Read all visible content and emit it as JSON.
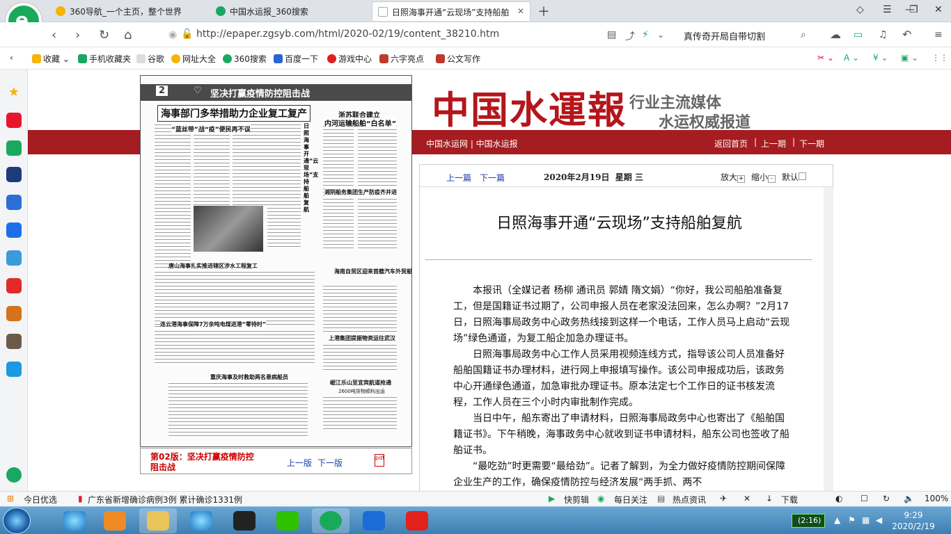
{
  "tabs": [
    {
      "title": "360导航_一个主页，整个世界",
      "color": "#f5b400"
    },
    {
      "title": "中国水运报_360搜索",
      "color": "#1aa860"
    },
    {
      "title": "日照海事开通“云现场”支持船舶",
      "color": "#bbbbbb"
    }
  ],
  "address": {
    "url": "http://epaper.zgsyb.com/html/2020-02/19/content_38210.htm",
    "search_text": "真传奇开局自带切割"
  },
  "bookmarks": [
    {
      "label": "收藏",
      "color": "#f5b400"
    },
    {
      "label": "手机收藏夹",
      "color": "#1aa860"
    },
    {
      "label": "谷歌",
      "color": "#999999"
    },
    {
      "label": "网址大全",
      "color": "#f5b400"
    },
    {
      "label": "360搜索",
      "color": "#1aa860"
    },
    {
      "label": "百度一下",
      "color": "#2a63d4"
    },
    {
      "label": "游戏中心",
      "color": "#e02020"
    },
    {
      "label": "六字亮点",
      "color": "#c0392b"
    },
    {
      "label": "公文写作",
      "color": "#c0392b"
    }
  ],
  "newspaper": {
    "masthead": "中国水運報",
    "slogan1": "行业主流媒体",
    "slogan2": "水运权威报道",
    "nav_left": "中国水运网 | 中国水运报",
    "nav_right": [
      "返回首页",
      "上一期",
      "下一期"
    ],
    "page_image": {
      "banner": "坚决打赢疫情防控阻击战",
      "page_no": "2",
      "headline": "海事部门多举措助力企业复工复产",
      "sub1": "“蓝丝带”战“疫”便民再不误",
      "sub2": "浙苏联合建立",
      "sub2b": "内河运输船舶“白名单”",
      "sub3": "湘阴船务集团生产防疫齐并进",
      "sub4": "唐山海事扎实推进辖区涉水工程复工",
      "sub5": "连云港海事保障7万余吨电煤进港“零待时”",
      "sub6": "海南自贸区迎来首艘汽车外贸船",
      "sub7": "上港集团提振物资运往武汉",
      "sub8": "重庆海事及时救助两名患病船员",
      "sub9": "岷江乐山至宜宾航道抢通",
      "sub9b": "2600吨货物顺利出运",
      "vert": "日照海事开通“云现场”支持船舶复航"
    },
    "caption": {
      "title": "第02版：坚决打赢疫情防控阻击战",
      "prev": "上一版",
      "next": "下一版"
    }
  },
  "article": {
    "prev": "上一篇",
    "next": "下一篇",
    "date": "2020年2月19日  星期 三",
    "zoom_in": "放大",
    "zoom_out": "缩小",
    "default": "默认",
    "title": "日照海事开通“云现场”支持船舶复航",
    "p1": "本报讯（全媒记者 杨柳 通讯员 郭婧 隋文娟）“你好，我公司船舶准备复工，但是国籍证书过期了，公司申报人员在老家没法回来，怎么办啊？”2月17日，日照海事局政务中心政务热线接到这样一个电话，工作人员马上启动“云现场”绿色通道，为复工船企加急办理证书。",
    "p2": "日照海事局政务中心工作人员采用视频连线方式，指导该公司人员准备好船舶国籍证书办理材料，进行网上申报填写操作。该公司申报成功后，该政务中心开通绿色通道，加急审批办理证书。原本法定七个工作日的证书核发流程，工作人员在三个小时内审批制作完成。",
    "p3": "当日中午，船东寄出了申请材料，日照海事局政务中心也寄出了《船舶国籍证书》。下午稍晚，海事政务中心就收到证书申请材料，船东公司也签收了船舶证书。",
    "p4": "“最吃劲”时更需要“最给劲”。记者了解到，为全力做好疫情防控期间保障企业生产的工作，确保疫情防控与经济发展“两手抓、两不"
  },
  "status": {
    "left": "今日优选",
    "news": "广东省新增确诊病例3例 累计确诊1331例",
    "items": [
      "快剪辑",
      "每日关注",
      "热点资讯",
      "下载"
    ],
    "zoom": "100%"
  },
  "taskbar": {
    "battery": "(2:16)",
    "time": "9:29",
    "date": "2020/2/19"
  },
  "colors": {
    "accent": "#a51c21",
    "link": "#1a3fb0"
  }
}
